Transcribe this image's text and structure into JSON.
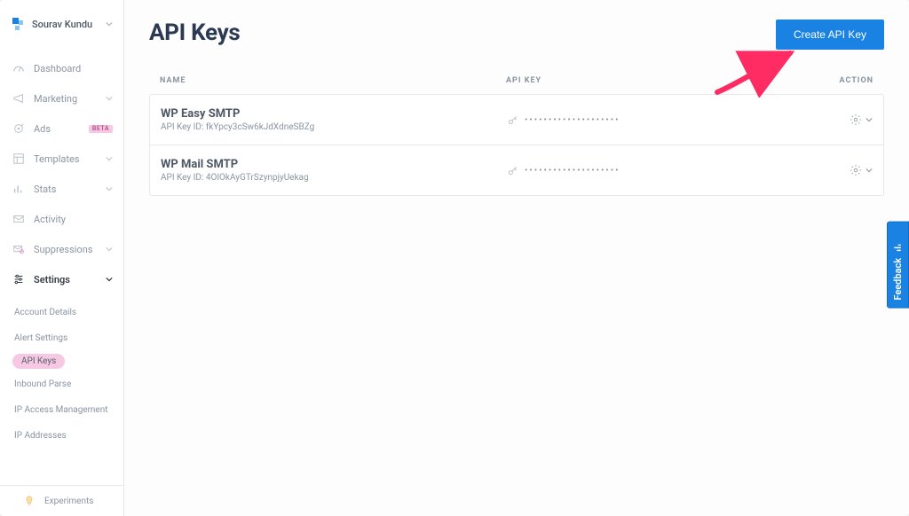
{
  "user": {
    "name": "Sourav Kundu"
  },
  "sidebar": {
    "items": [
      {
        "label": "Dashboard"
      },
      {
        "label": "Marketing"
      },
      {
        "label": "Ads",
        "beta": "BETA"
      },
      {
        "label": "Templates"
      },
      {
        "label": "Stats"
      },
      {
        "label": "Activity"
      },
      {
        "label": "Suppressions"
      },
      {
        "label": "Settings"
      }
    ],
    "subnav": [
      "Account Details",
      "Alert Settings",
      "API Keys",
      "Inbound Parse",
      "IP Access Management",
      "IP Addresses"
    ],
    "experiments": "Experiments"
  },
  "page": {
    "title": "API Keys",
    "create_button": "Create API Key"
  },
  "table": {
    "headers": {
      "name": "NAME",
      "apikey": "API KEY",
      "action": "ACTION"
    },
    "rows": [
      {
        "name": "WP Easy SMTP",
        "subprefix": "API Key ID: ",
        "sub": "fkYpcy3cSw6kJdXdneSBZg",
        "mask": "••••••••••••••••••••"
      },
      {
        "name": "WP Mail SMTP",
        "subprefix": "API Key ID: ",
        "sub": "4OIOkAyGTrSzynpjyUekag",
        "mask": "••••••••••••••••••••"
      }
    ]
  },
  "feedback": {
    "label": "Feedback"
  }
}
